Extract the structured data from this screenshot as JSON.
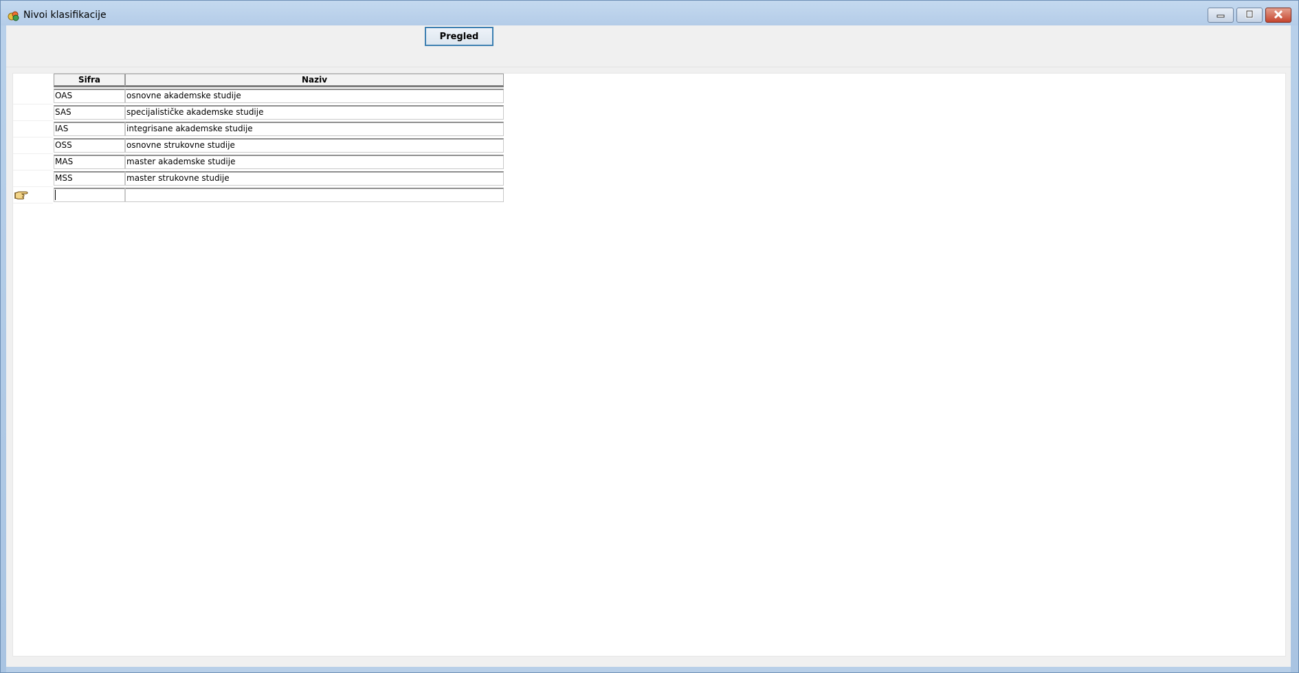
{
  "window": {
    "title": "Nivoi klasifikacije",
    "icon": "app-icon",
    "controls": {
      "minimize": "minimize-icon",
      "maximize": "maximize-icon",
      "close": "close-icon"
    }
  },
  "toolbar": {
    "pregled_label": "Pregled"
  },
  "grid": {
    "columns": [
      "Sifra",
      "Naziv"
    ],
    "rows": [
      {
        "code": "OAS",
        "name": "osnovne akademske studije"
      },
      {
        "code": "SAS",
        "name": "specijalističke akademske studije"
      },
      {
        "code": "IAS",
        "name": "integrisane akademske studije"
      },
      {
        "code": "OSS",
        "name": "osnovne strukovne studije"
      },
      {
        "code": "MAS",
        "name": "master akademske studije"
      },
      {
        "code": "MSS",
        "name": "master strukovne studije"
      }
    ],
    "new_row": {
      "code": "",
      "name": ""
    },
    "current_row_indicator": "pointing-hand-icon"
  }
}
